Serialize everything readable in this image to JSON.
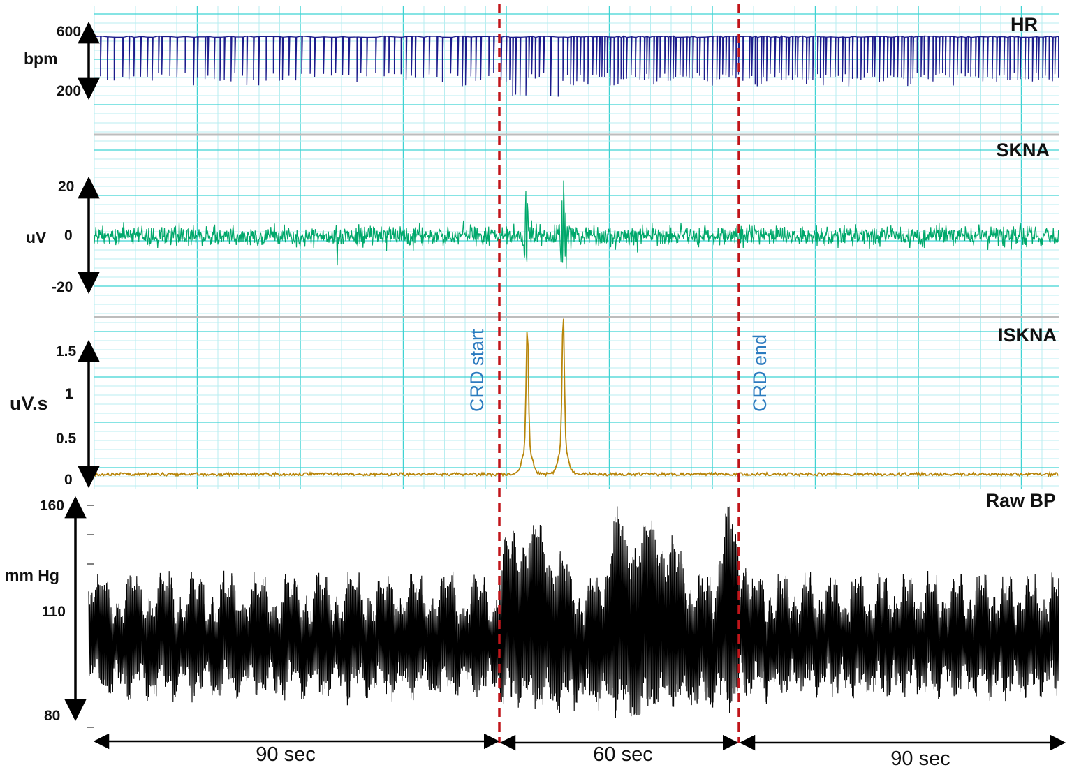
{
  "colors": {
    "background": "#ffffff",
    "grid_major": "#3fd3d3",
    "grid_minor": "#b8eef0",
    "separator": "#bdbdbd",
    "hr": "#1c1c8c",
    "hr_fill": "#7b7bc6",
    "skna": "#00a86b",
    "iskna": "#b8860b",
    "bp": "#000000",
    "event_line": "#c0151a",
    "event_text": "#2b7bbf"
  },
  "chart_data": [
    {
      "type": "line",
      "title": "HR",
      "ylabel": "bpm",
      "yticks": [
        "600",
        "200"
      ],
      "ylim": [
        200,
        600
      ],
      "description_series": "beat-to-beat heart rate; mostly ~560 bpm with frequent downward spikes to ~230 bpm; deeper dips to ~160 bpm early in CRD",
      "series": [
        {
          "values_bpm_baseline": 560,
          "spike_min": 230,
          "crd_dips_min": 160
        }
      ]
    },
    {
      "type": "line",
      "title": "SKNA",
      "ylabel": "uV",
      "yticks": [
        "20",
        "0",
        "-20"
      ],
      "ylim": [
        -20,
        20
      ],
      "series": [
        {
          "baseline_amplitude_uV": 5,
          "bursts": [
            {
              "t_sec": 97,
              "amplitude_uV": 26
            },
            {
              "t_sec": 106,
              "amplitude_uV": 26
            }
          ]
        }
      ]
    },
    {
      "type": "line",
      "title": "ISKNA",
      "ylabel": "uV.s",
      "yticks": [
        "1.5",
        "1",
        "0.5",
        "0"
      ],
      "ylim": [
        0,
        1.5
      ],
      "series": [
        {
          "baseline": 0.03,
          "peaks": [
            {
              "t_sec": 97,
              "value": 1.43
            },
            {
              "t_sec": 106,
              "value": 1.58
            }
          ]
        }
      ]
    },
    {
      "type": "line",
      "title": "Raw BP",
      "ylabel": "mm Hg",
      "yticks": [
        "160",
        "110",
        "80"
      ],
      "ylim": [
        80,
        160
      ],
      "series": [
        {
          "diastolic_approx": 90,
          "systolic_approx": 128,
          "crd_max": 160,
          "crd_min": 78
        }
      ]
    }
  ],
  "events": {
    "start_label": "CRD start",
    "end_label": "CRD end"
  },
  "durations": {
    "pre": "90 sec",
    "during": "60 sec",
    "post": "90 sec"
  }
}
